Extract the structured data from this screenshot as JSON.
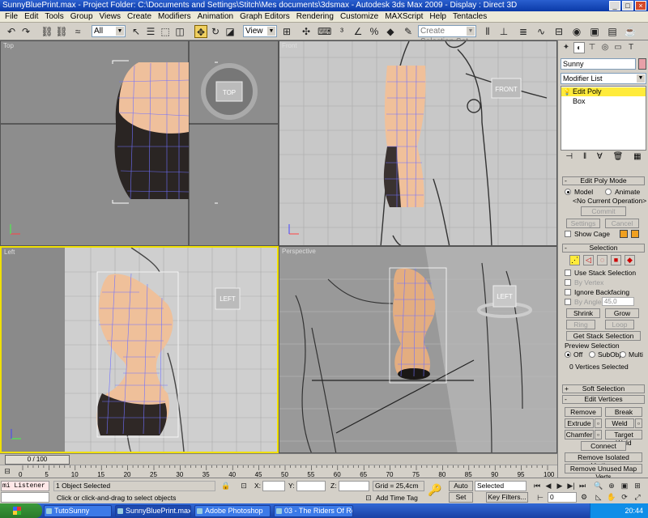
{
  "window": {
    "title": "SunnyBluePrint.max    - Project Folder: C:\\Documents and Settings\\Stitch\\Mes documents\\3dsmax    - Autodesk 3ds Max  2009      - Display : Direct 3D"
  },
  "menubar": [
    "File",
    "Edit",
    "Tools",
    "Group",
    "Views",
    "Create",
    "Modifiers",
    "Animation",
    "Graph Editors",
    "Rendering",
    "Customize",
    "MAXScript",
    "Help",
    "Tentacles"
  ],
  "toolbar": {
    "selection_filter": "All",
    "reference_coord": "View",
    "named_selection_placeholder": "Create Selection Set"
  },
  "viewports": {
    "top": {
      "label": "Top",
      "cube": "TOP"
    },
    "front": {
      "label": "Front",
      "cube": "FRONT"
    },
    "left": {
      "label": "Left",
      "cube": "LEFT"
    },
    "perspective": {
      "label": "Perspective",
      "cube": "LEFT"
    }
  },
  "command_panel": {
    "object_name": "Sunny",
    "object_color": "#e8a0a8",
    "modifier_list": "Modifier List",
    "stack": {
      "active": "Edit Poly",
      "base": "Box"
    },
    "edit_poly_mode": {
      "title": "Edit Poly Mode",
      "model": "Model",
      "animate": "Animate",
      "operation": "<No Current Operation>",
      "commit": "Commit",
      "settings": "Settings",
      "cancel": "Cancel",
      "show_cage": "Show Cage"
    },
    "selection": {
      "title": "Selection",
      "use_stack": "Use Stack Selection",
      "by_vertex": "By Vertex",
      "ignore_backfacing": "Ignore Backfacing",
      "by_angle": "By Angle:",
      "angle_value": "45,0",
      "shrink": "Shrink",
      "grow": "Grow",
      "ring": "Ring",
      "loop": "Loop",
      "get_stack_selection": "Get Stack Selection",
      "preview_title": "Preview Selection",
      "off": "Off",
      "subobj": "SubObj",
      "multi": "Multi",
      "status": "0 Vertices Selected"
    },
    "soft_selection": "Soft Selection",
    "edit_vertices": {
      "title": "Edit Vertices",
      "remove": "Remove",
      "break": "Break",
      "extrude": "Extrude",
      "weld": "Weld",
      "chamfer": "Chamfer",
      "target_weld": "Target Weld",
      "connect": "Connect",
      "remove_isolated": "Remove Isolated Vertices",
      "remove_unused": "Remove Unused Map Verts"
    }
  },
  "timeline": {
    "frame_readout": "0 / 100",
    "ticks": [
      "0",
      "5",
      "10",
      "15",
      "20",
      "25",
      "30",
      "35",
      "40",
      "45",
      "50",
      "55",
      "60",
      "65",
      "70",
      "75",
      "80",
      "85",
      "90",
      "95",
      "100"
    ]
  },
  "status": {
    "listener": "mi Listener",
    "objects_selected": "1 Object Selected",
    "prompt": "Click or click-and-drag to select objects",
    "x_label": "X:",
    "y_label": "Y:",
    "z_label": "Z:",
    "grid": "Grid = 25,4cm",
    "add_time_tag": "Add Time Tag",
    "auto_key": "Auto Key",
    "set_key": "Set Key",
    "key_mode": "Selected",
    "key_filters": "Key Filters...",
    "current_frame": "0"
  },
  "taskbar": {
    "tasks": [
      "TutoSunny",
      "SunnyBluePrint.max ...",
      "Adobe Photoshop",
      "03 - The Riders Of Ro..."
    ],
    "clock": "20:44"
  },
  "colors": {
    "viewport_bg": "#8c8c8c",
    "skin": "#e8b48c",
    "active_border": "#f0e000",
    "stack_highlight": "#ffeb3b"
  }
}
